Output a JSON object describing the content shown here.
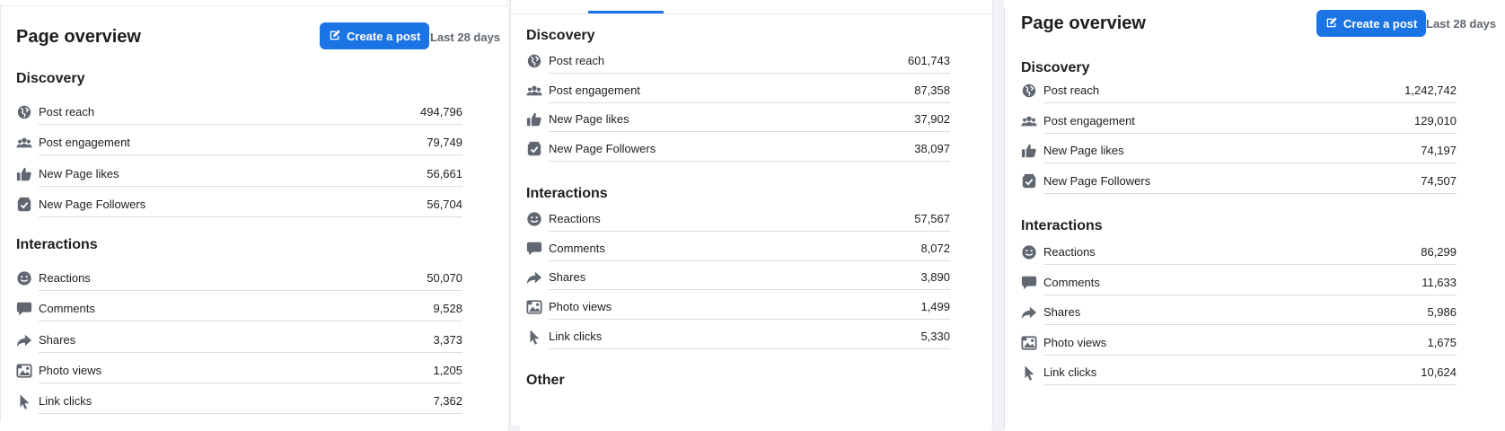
{
  "colors": {
    "accent": "#1b74e4",
    "icon": "#606770",
    "text": "#1c1e21",
    "muted": "#606770"
  },
  "panel1": {
    "title": "Page overview",
    "create_post_label": "Create a post",
    "period_label": "Last 28 days",
    "discovery": {
      "title": "Discovery",
      "rows": [
        {
          "label": "Post reach",
          "value": "494,796",
          "icon": "globe-icon"
        },
        {
          "label": "Post engagement",
          "value": "79,749",
          "icon": "people-icon"
        },
        {
          "label": "New Page likes",
          "value": "56,661",
          "icon": "thumbs-up-icon"
        },
        {
          "label": "New Page Followers",
          "value": "56,704",
          "icon": "follower-icon"
        }
      ]
    },
    "interactions": {
      "title": "Interactions",
      "rows": [
        {
          "label": "Reactions",
          "value": "50,070",
          "icon": "smiley-icon"
        },
        {
          "label": "Comments",
          "value": "9,528",
          "icon": "comment-icon"
        },
        {
          "label": "Shares",
          "value": "3,373",
          "icon": "share-icon"
        },
        {
          "label": "Photo views",
          "value": "1,205",
          "icon": "photo-icon"
        },
        {
          "label": "Link clicks",
          "value": "7,362",
          "icon": "cursor-icon"
        }
      ]
    }
  },
  "panel2": {
    "discovery": {
      "title": "Discovery",
      "rows": [
        {
          "label": "Post reach",
          "value": "601,743",
          "icon": "globe-icon"
        },
        {
          "label": "Post engagement",
          "value": "87,358",
          "icon": "people-icon"
        },
        {
          "label": "New Page likes",
          "value": "37,902",
          "icon": "thumbs-up-icon"
        },
        {
          "label": "New Page Followers",
          "value": "38,097",
          "icon": "follower-icon"
        }
      ]
    },
    "interactions": {
      "title": "Interactions",
      "rows": [
        {
          "label": "Reactions",
          "value": "57,567",
          "icon": "smiley-icon"
        },
        {
          "label": "Comments",
          "value": "8,072",
          "icon": "comment-icon"
        },
        {
          "label": "Shares",
          "value": "3,890",
          "icon": "share-icon"
        },
        {
          "label": "Photo views",
          "value": "1,499",
          "icon": "photo-icon"
        },
        {
          "label": "Link clicks",
          "value": "5,330",
          "icon": "cursor-icon"
        }
      ]
    },
    "other_title": "Other"
  },
  "panel3": {
    "title": "Page overview",
    "create_post_label": "Create a post",
    "period_label": "Last 28 days",
    "discovery": {
      "title": "Discovery",
      "rows": [
        {
          "label": "Post reach",
          "value": "1,242,742",
          "icon": "globe-icon"
        },
        {
          "label": "Post engagement",
          "value": "129,010",
          "icon": "people-icon"
        },
        {
          "label": "New Page likes",
          "value": "74,197",
          "icon": "thumbs-up-icon"
        },
        {
          "label": "New Page Followers",
          "value": "74,507",
          "icon": "follower-icon"
        }
      ]
    },
    "interactions": {
      "title": "Interactions",
      "rows": [
        {
          "label": "Reactions",
          "value": "86,299",
          "icon": "smiley-icon"
        },
        {
          "label": "Comments",
          "value": "11,633",
          "icon": "comment-icon"
        },
        {
          "label": "Shares",
          "value": "5,986",
          "icon": "share-icon"
        },
        {
          "label": "Photo views",
          "value": "1,675",
          "icon": "photo-icon"
        },
        {
          "label": "Link clicks",
          "value": "10,624",
          "icon": "cursor-icon"
        }
      ]
    }
  }
}
